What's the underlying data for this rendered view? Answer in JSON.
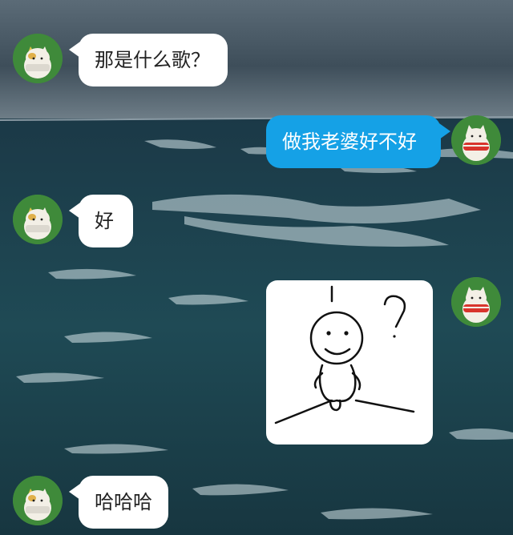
{
  "messages": [
    {
      "side": "left",
      "text": "那是什么歌？"
    },
    {
      "side": "right",
      "text": "做我老婆好不好"
    },
    {
      "side": "left",
      "text": "好"
    },
    {
      "side": "right",
      "type": "sticker",
      "sticker": "stick-figure-question-mark"
    },
    {
      "side": "left",
      "text": "哈哈哈"
    }
  ],
  "colors": {
    "incoming_bubble": "#ffffff",
    "outgoing_bubble": "#15a1e6",
    "sky": "#4a5a66",
    "sea": "#1d3a45"
  },
  "icons": {
    "incoming_avatar": "cat-avatar-white-scarf",
    "outgoing_avatar": "cat-avatar-red-scarf"
  }
}
